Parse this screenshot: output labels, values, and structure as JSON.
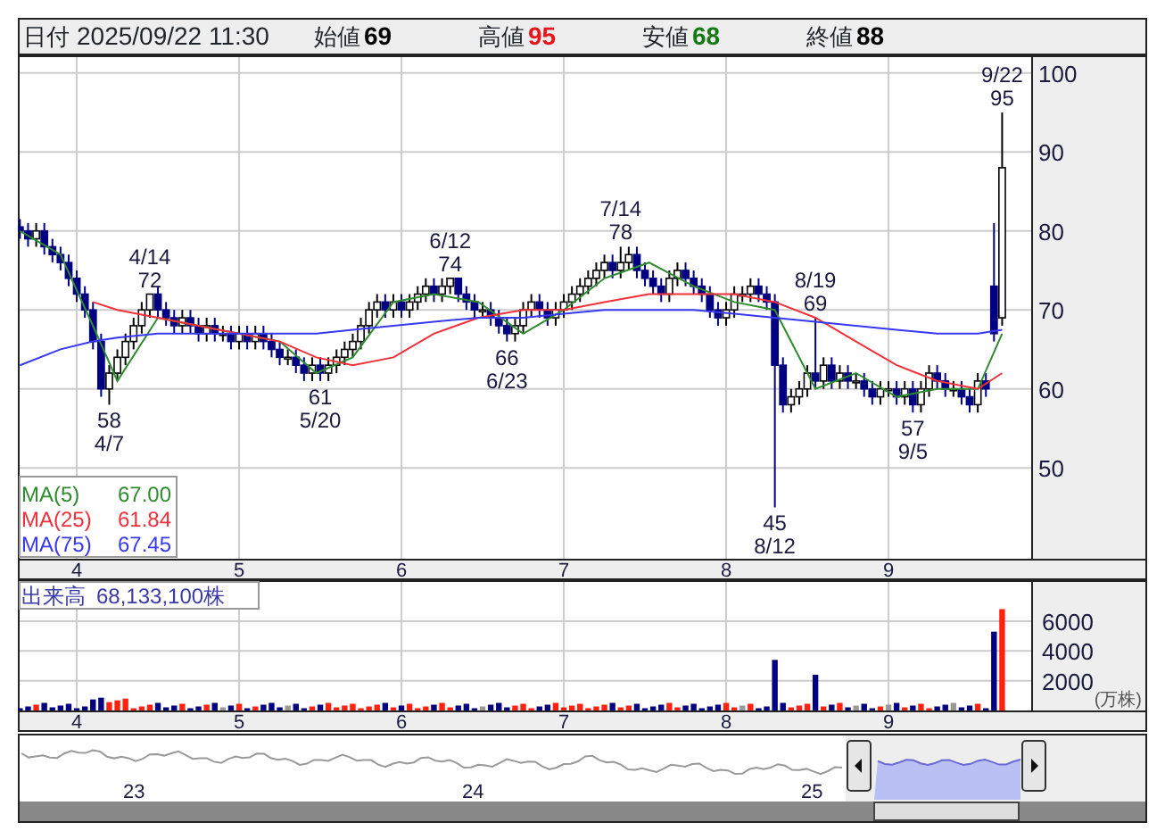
{
  "header": {
    "date_label": "日付",
    "datetime": "2025/09/22 11:30",
    "quotes": [
      {
        "label": "始値",
        "value": "69",
        "color": "#000000"
      },
      {
        "label": "高値",
        "value": "95",
        "color": "#e8141e"
      },
      {
        "label": "安値",
        "value": "68",
        "color": "#157a15"
      },
      {
        "label": "終値",
        "value": "88",
        "color": "#000000"
      }
    ]
  },
  "price_chart": {
    "annotations": [
      {
        "date": "4/14",
        "value": "72",
        "kind": "high"
      },
      {
        "date": "4/7",
        "value": "58",
        "kind": "low"
      },
      {
        "date": "5/20",
        "value": "61",
        "kind": "low"
      },
      {
        "date": "6/12",
        "value": "74",
        "kind": "high"
      },
      {
        "date": "6/23",
        "value": "66",
        "kind": "low"
      },
      {
        "date": "7/14",
        "value": "78",
        "kind": "high"
      },
      {
        "date": "8/12",
        "value": "45",
        "kind": "low"
      },
      {
        "date": "8/19",
        "value": "69",
        "kind": "high"
      },
      {
        "date": "9/5",
        "value": "57",
        "kind": "low"
      },
      {
        "date": "9/22",
        "value": "95",
        "kind": "high"
      }
    ],
    "chart_data": {
      "type": "candlestick",
      "x": [
        3.65,
        3.7,
        3.75,
        3.8,
        3.85,
        3.9,
        3.95,
        4,
        4.05,
        4.1,
        4.15,
        4.2,
        4.25,
        4.3,
        4.35,
        4.4,
        4.45,
        4.5,
        4.55,
        4.6,
        4.65,
        4.7,
        4.75,
        4.8,
        4.85,
        4.9,
        4.95,
        5,
        5.05,
        5.1,
        5.15,
        5.2,
        5.25,
        5.3,
        5.35,
        5.4,
        5.45,
        5.5,
        5.55,
        5.6,
        5.65,
        5.7,
        5.75,
        5.8,
        5.85,
        5.9,
        5.95,
        6,
        6.05,
        6.1,
        6.15,
        6.2,
        6.25,
        6.3,
        6.35,
        6.4,
        6.45,
        6.5,
        6.55,
        6.6,
        6.65,
        6.7,
        6.75,
        6.8,
        6.85,
        6.9,
        6.95,
        7,
        7.05,
        7.1,
        7.15,
        7.2,
        7.25,
        7.3,
        7.35,
        7.4,
        7.45,
        7.5,
        7.55,
        7.6,
        7.65,
        7.7,
        7.75,
        7.8,
        7.85,
        7.9,
        7.95,
        8,
        8.05,
        8.1,
        8.15,
        8.2,
        8.25,
        8.3,
        8.35,
        8.4,
        8.45,
        8.5,
        8.55,
        8.6,
        8.65,
        8.7,
        8.75,
        8.8,
        8.85,
        8.9,
        8.95,
        9,
        9.05,
        9.1,
        9.15,
        9.2,
        9.25,
        9.3,
        9.35,
        9.4,
        9.45,
        9.5,
        9.55,
        9.6,
        9.65,
        9.7
      ],
      "ohlc": [
        [
          80.5,
          81.5,
          79,
          80
        ],
        [
          80,
          81,
          78,
          79
        ],
        [
          79,
          81,
          78,
          80
        ],
        [
          80,
          81,
          77,
          78
        ],
        [
          78,
          79,
          76,
          77
        ],
        [
          77,
          78,
          75,
          76
        ],
        [
          76,
          77,
          73,
          74
        ],
        [
          74,
          75,
          71,
          72
        ],
        [
          72,
          73,
          69,
          70
        ],
        [
          70,
          71,
          65,
          66
        ],
        [
          66,
          67,
          59,
          60
        ],
        [
          60,
          63,
          58,
          62
        ],
        [
          62,
          65,
          61,
          64
        ],
        [
          64,
          67,
          63,
          66
        ],
        [
          66,
          69,
          65,
          68
        ],
        [
          68,
          71,
          67,
          70
        ],
        [
          70,
          72,
          69,
          72
        ],
        [
          72,
          73,
          69,
          70
        ],
        [
          70,
          71,
          68,
          69
        ],
        [
          69,
          70,
          67,
          68
        ],
        [
          68,
          70,
          67,
          69
        ],
        [
          69,
          70,
          67,
          68
        ],
        [
          68,
          69,
          66,
          67
        ],
        [
          67,
          69,
          66,
          68
        ],
        [
          68,
          69,
          66,
          67
        ],
        [
          67,
          68,
          66,
          67
        ],
        [
          67,
          68,
          65,
          66
        ],
        [
          66,
          68,
          65,
          67
        ],
        [
          67,
          68,
          65,
          66
        ],
        [
          66,
          68,
          65,
          67
        ],
        [
          67,
          68,
          65,
          66
        ],
        [
          66,
          67,
          64,
          65
        ],
        [
          65,
          66,
          63,
          64
        ],
        [
          64,
          65,
          63,
          64
        ],
        [
          64,
          65,
          62,
          63
        ],
        [
          63,
          64,
          61,
          62
        ],
        [
          62,
          64,
          61,
          63
        ],
        [
          63,
          64,
          61,
          62
        ],
        [
          62,
          64,
          61,
          63
        ],
        [
          63,
          65,
          62,
          64
        ],
        [
          64,
          66,
          63,
          65
        ],
        [
          65,
          67,
          64,
          66
        ],
        [
          66,
          69,
          65,
          68
        ],
        [
          68,
          71,
          67,
          70
        ],
        [
          70,
          72,
          69,
          71
        ],
        [
          71,
          72,
          69,
          70
        ],
        [
          70,
          72,
          69,
          71
        ],
        [
          71,
          72,
          69,
          70
        ],
        [
          70,
          72,
          69,
          71
        ],
        [
          71,
          73,
          70,
          72
        ],
        [
          72,
          74,
          71,
          73
        ],
        [
          73,
          74,
          71,
          72
        ],
        [
          72,
          74,
          71,
          73
        ],
        [
          73,
          74,
          72,
          74
        ],
        [
          74,
          74,
          71,
          72
        ],
        [
          72,
          73,
          70,
          71
        ],
        [
          71,
          72,
          69,
          70
        ],
        [
          70,
          71,
          69,
          70
        ],
        [
          70,
          71,
          68,
          69
        ],
        [
          69,
          70,
          67,
          68
        ],
        [
          68,
          69,
          66,
          67
        ],
        [
          67,
          69,
          66,
          68
        ],
        [
          68,
          71,
          67,
          70
        ],
        [
          70,
          72,
          69,
          71
        ],
        [
          71,
          72,
          69,
          70
        ],
        [
          70,
          71,
          68,
          69
        ],
        [
          69,
          71,
          68,
          70
        ],
        [
          70,
          72,
          69,
          71
        ],
        [
          71,
          73,
          70,
          72
        ],
        [
          72,
          74,
          71,
          73
        ],
        [
          73,
          75,
          72,
          74
        ],
        [
          74,
          76,
          73,
          75
        ],
        [
          75,
          77,
          74,
          76
        ],
        [
          76,
          77,
          74,
          75
        ],
        [
          75,
          78,
          74,
          76
        ],
        [
          76,
          78,
          75,
          77
        ],
        [
          77,
          78,
          74,
          75
        ],
        [
          75,
          76,
          73,
          74
        ],
        [
          74,
          75,
          72,
          73
        ],
        [
          73,
          74,
          71,
          72
        ],
        [
          72,
          75,
          71,
          74
        ],
        [
          74,
          76,
          73,
          75
        ],
        [
          75,
          76,
          73,
          74
        ],
        [
          74,
          75,
          72,
          73
        ],
        [
          73,
          74,
          71,
          72
        ],
        [
          72,
          73,
          69,
          70
        ],
        [
          70,
          71,
          68,
          69
        ],
        [
          69,
          71,
          68,
          70
        ],
        [
          70,
          73,
          69,
          72
        ],
        [
          72,
          73,
          71,
          72
        ],
        [
          72,
          74,
          71,
          73
        ],
        [
          73,
          74,
          71,
          72
        ],
        [
          72,
          73,
          70,
          71
        ],
        [
          71,
          72,
          45,
          63
        ],
        [
          63,
          64,
          57,
          58
        ],
        [
          58,
          60,
          57,
          59
        ],
        [
          59,
          61,
          58,
          60
        ],
        [
          60,
          63,
          59,
          62
        ],
        [
          62,
          69,
          60,
          61
        ],
        [
          61,
          64,
          60,
          63
        ],
        [
          63,
          64,
          60,
          61
        ],
        [
          61,
          63,
          60,
          62
        ],
        [
          62,
          63,
          60,
          61
        ],
        [
          61,
          62,
          60,
          61
        ],
        [
          61,
          62,
          59,
          60
        ],
        [
          60,
          61,
          58,
          59
        ],
        [
          59,
          61,
          58,
          60
        ],
        [
          60,
          61,
          59,
          60
        ],
        [
          60,
          61,
          58,
          59
        ],
        [
          59,
          61,
          58,
          60
        ],
        [
          60,
          61,
          57,
          58
        ],
        [
          58,
          61,
          57,
          60
        ],
        [
          60,
          63,
          59,
          62
        ],
        [
          62,
          63,
          60,
          61
        ],
        [
          61,
          62,
          59,
          60
        ],
        [
          60,
          61,
          59,
          60
        ],
        [
          60,
          61,
          58,
          59
        ],
        [
          59,
          60,
          57,
          58
        ],
        [
          58,
          62,
          57,
          61
        ],
        [
          61,
          62,
          59,
          60
        ],
        [
          73,
          81,
          66,
          67
        ],
        [
          69,
          95,
          68,
          88
        ]
      ],
      "xlim": [
        3.637,
        9.879
      ],
      "xticks": [
        4,
        5,
        6,
        7,
        8,
        9
      ],
      "ylim": [
        38.5,
        102
      ],
      "yticks": [
        100,
        90,
        80,
        70,
        60,
        50
      ],
      "grid": true
    },
    "moving_averages": {
      "legend_values": [
        "67.00",
        "61.84",
        "67.45"
      ],
      "chart_data": {
        "type": "line",
        "x": [
          3.65,
          3.9,
          4.1,
          4.25,
          4.5,
          4.75,
          5,
          5.25,
          5.475,
          5.7,
          5.95,
          6.2,
          6.475,
          6.75,
          7,
          7.25,
          7.525,
          7.8,
          8.05,
          8.3,
          8.55,
          8.8,
          9.05,
          9.3,
          9.55,
          9.7
        ],
        "xlim": [
          3.637,
          9.879
        ],
        "ylim": [
          38.5,
          102
        ],
        "series": [
          {
            "name": "MA(5)",
            "color": "#2e8b2e",
            "values": [
              80,
              77,
              68,
              61,
              69,
              68,
              67,
              66,
              62,
              64,
              71,
              72,
              71,
              67,
              70,
              74,
              76,
              73,
              71,
              70,
              60,
              62,
              59,
              60,
              60,
              67
            ]
          },
          {
            "name": "MA(25)",
            "color": "#f0303a",
            "values": [
              null,
              null,
              71,
              70,
              69,
              68,
              67,
              66,
              64,
              63,
              64,
              67,
              69,
              70,
              70,
              71,
              72,
              72,
              72,
              71,
              69,
              66,
              63,
              61,
              60,
              62
            ]
          },
          {
            "name": "MA(75)",
            "color": "#3838f0",
            "values": [
              63,
              65,
              66,
              66.5,
              67,
              67,
              67,
              67,
              67,
              67.5,
              68,
              68.5,
              69,
              69,
              69.5,
              70,
              70,
              70,
              69.5,
              69,
              68.5,
              68,
              67.5,
              67,
              67,
              67.5
            ]
          }
        ]
      }
    }
  },
  "volume_chart": {
    "label": "出来高",
    "total": "68,133,100株",
    "unit": "(万株)",
    "chart_data": {
      "type": "bar",
      "x": [
        3.65,
        3.7,
        3.75,
        3.8,
        3.85,
        3.9,
        3.95,
        4,
        4.05,
        4.1,
        4.15,
        4.2,
        4.25,
        4.3,
        4.35,
        4.4,
        4.45,
        4.5,
        4.55,
        4.6,
        4.65,
        4.7,
        4.75,
        4.8,
        4.85,
        4.9,
        4.95,
        5,
        5.05,
        5.1,
        5.15,
        5.2,
        5.25,
        5.3,
        5.35,
        5.4,
        5.45,
        5.5,
        5.55,
        5.6,
        5.65,
        5.7,
        5.75,
        5.8,
        5.85,
        5.9,
        5.95,
        6,
        6.05,
        6.1,
        6.15,
        6.2,
        6.25,
        6.3,
        6.35,
        6.4,
        6.45,
        6.5,
        6.55,
        6.6,
        6.65,
        6.7,
        6.75,
        6.8,
        6.85,
        6.9,
        6.95,
        7,
        7.05,
        7.1,
        7.15,
        7.2,
        7.25,
        7.3,
        7.35,
        7.4,
        7.45,
        7.5,
        7.55,
        7.6,
        7.65,
        7.7,
        7.75,
        7.8,
        7.85,
        7.9,
        7.95,
        8,
        8.05,
        8.1,
        8.15,
        8.2,
        8.25,
        8.3,
        8.35,
        8.4,
        8.45,
        8.5,
        8.55,
        8.6,
        8.65,
        8.7,
        8.75,
        8.8,
        8.85,
        8.9,
        8.95,
        9,
        9.05,
        9.1,
        9.15,
        9.2,
        9.25,
        9.3,
        9.35,
        9.4,
        9.45,
        9.5,
        9.55,
        9.6,
        9.65,
        9.7
      ],
      "values": [
        150,
        270,
        390,
        510,
        210,
        330,
        450,
        150,
        270,
        740,
        860,
        560,
        680,
        800,
        150,
        270,
        390,
        510,
        210,
        330,
        450,
        150,
        270,
        390,
        510,
        210,
        330,
        450,
        150,
        270,
        390,
        510,
        210,
        330,
        450,
        150,
        270,
        390,
        510,
        210,
        330,
        450,
        150,
        270,
        390,
        510,
        210,
        330,
        450,
        150,
        270,
        390,
        510,
        210,
        330,
        450,
        150,
        270,
        390,
        510,
        210,
        330,
        450,
        150,
        270,
        390,
        510,
        210,
        330,
        450,
        150,
        270,
        390,
        510,
        210,
        330,
        450,
        150,
        270,
        390,
        510,
        210,
        330,
        450,
        150,
        270,
        390,
        510,
        210,
        330,
        450,
        150,
        270,
        3400,
        510,
        210,
        330,
        450,
        2400,
        270,
        390,
        510,
        210,
        330,
        450,
        150,
        270,
        390,
        510,
        210,
        330,
        450,
        150,
        270,
        390,
        510,
        210,
        330,
        450,
        150,
        5300,
        6813
      ],
      "xlim": [
        3.637,
        9.879
      ],
      "xticks": [
        4,
        5,
        6,
        7,
        8,
        9
      ],
      "ylim": [
        0,
        8760
      ],
      "yticks": [
        6000,
        4000,
        2000
      ],
      "grid": true
    }
  },
  "navigator": {
    "year_labels": [
      "23",
      "24",
      "25"
    ]
  }
}
